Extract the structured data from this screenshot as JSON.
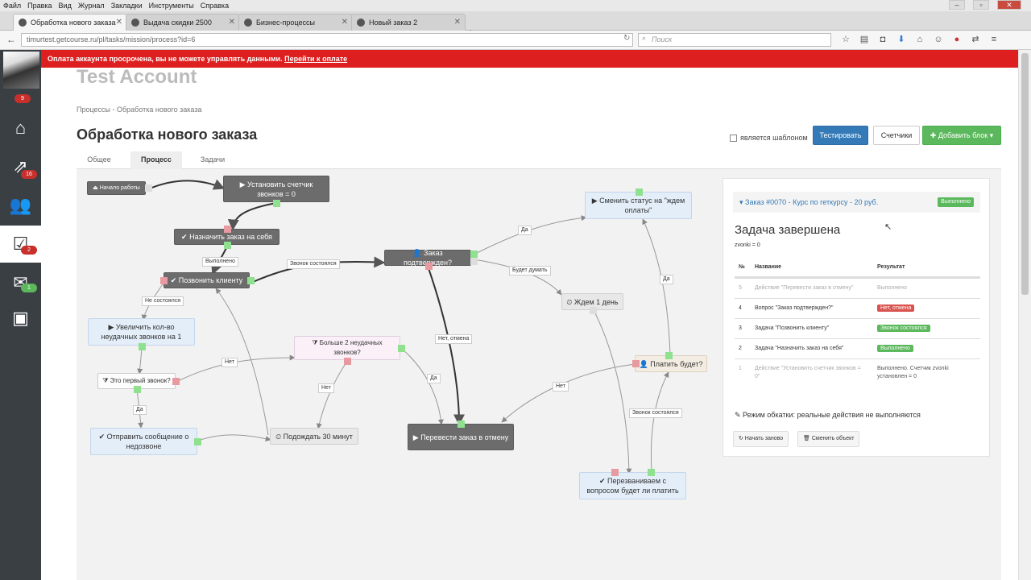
{
  "browser": {
    "menu": [
      "Файл",
      "Правка",
      "Вид",
      "Журнал",
      "Закладки",
      "Инструменты",
      "Справка"
    ],
    "tabs": [
      {
        "label": "Обработка нового заказа"
      },
      {
        "label": "Выдача скидки 2500"
      },
      {
        "label": "Бизнес-процессы"
      },
      {
        "label": "Новый заказ 2"
      }
    ],
    "url": "timurtest.getcourse.ru/pl/tasks/mission/process?id=6",
    "search_placeholder": "Поиск"
  },
  "sidebar": {
    "badges": {
      "top": "9",
      "chart": "16",
      "tasks": "2",
      "mail": "1"
    }
  },
  "alert": {
    "text": "Оплата аккаунта просрочена, вы не можете управлять данными.",
    "link": "Перейти к оплате"
  },
  "account": "Test Account",
  "breadcrumb": "Процессы - Обработка нового заказа",
  "page_title": "Обработка нового заказа",
  "toolbar": {
    "template_label": "является шаблоном",
    "test_label": "Тестировать",
    "counters_label": "Счетчики",
    "add_block_label": "✚ Добавить блок ▾"
  },
  "tabs": {
    "general": "Общее",
    "process": "Процесс",
    "tasks": "Задачи"
  },
  "nodes": {
    "start": "⏏ Начало работы",
    "set_counter": "▶ Установить счетчик звонков = 0",
    "assign": "✔ Назначить заказ на себя",
    "call_client": "✔ Позвонить клиенту",
    "order_confirmed": "👤 Заказ подтвержден?",
    "change_status": "▶ Сменить статус на \"ждем оплаты\"",
    "wait_day": "⏲ Ждем 1 день",
    "increase_calls": "▶ Увеличить кол-во неудачных звонков на 1",
    "more_than_two": "⧩ Больше 2 неудачных звонков?",
    "first_call": "⧩ Это первый звонок?",
    "send_message": "✔ Отправить сообщение о недозвоне",
    "wait_30": "⏲ Подождать 30 минут",
    "cancel_order": "▶ Перевести заказ в отмену",
    "will_pay": "👤 Платить будет?",
    "call_back": "✔ Перезваниваем с вопросом будет ли платить"
  },
  "edge_labels": {
    "done": "Выполнено",
    "call_ok": "Звонок состоялся",
    "call_fail": "Не состоялся",
    "yes1": "Да",
    "will_think": "Будет думать",
    "no_cancel": "Нет, отмена",
    "no1": "Нет",
    "no2": "Нет",
    "yes2": "Да",
    "yes3": "Да",
    "no3": "Нет",
    "yes4": "Да",
    "call_ok2": "Звонок состоялся"
  },
  "panel": {
    "header": "▾ Заказ #0070 - Курс по геткурсу - 20 руб.",
    "header_badge": "Выполнено",
    "title": "Задача завершена",
    "subtitle": "zvonki = 0",
    "columns": {
      "num": "№",
      "name": "Название",
      "result": "Результат"
    },
    "rows": [
      {
        "num": "5",
        "name": "Действие \"Перевести заказ в отмену\"",
        "result": "Выполнено"
      },
      {
        "num": "4",
        "name": "Вопрос \"Заказ подтвержден?\"",
        "result": "Нет, отмена"
      },
      {
        "num": "3",
        "name": "Задача \"Позвонить клиенту\"",
        "result": "Звонок состоялся"
      },
      {
        "num": "2",
        "name": "Задача \"Назначить заказ на себя\"",
        "result": "Выполнено"
      },
      {
        "num": "1",
        "name": "Действие \"Установить счетчик звонков = 0\"",
        "result": "Выполнено. Счетчик zvonki установлен = 0"
      }
    ],
    "mode_text": "Режим обкатки: реальные действия не выполняются",
    "restart_label": "↻ Начать заново",
    "change_object_label": "🗑 Сменить объект"
  }
}
